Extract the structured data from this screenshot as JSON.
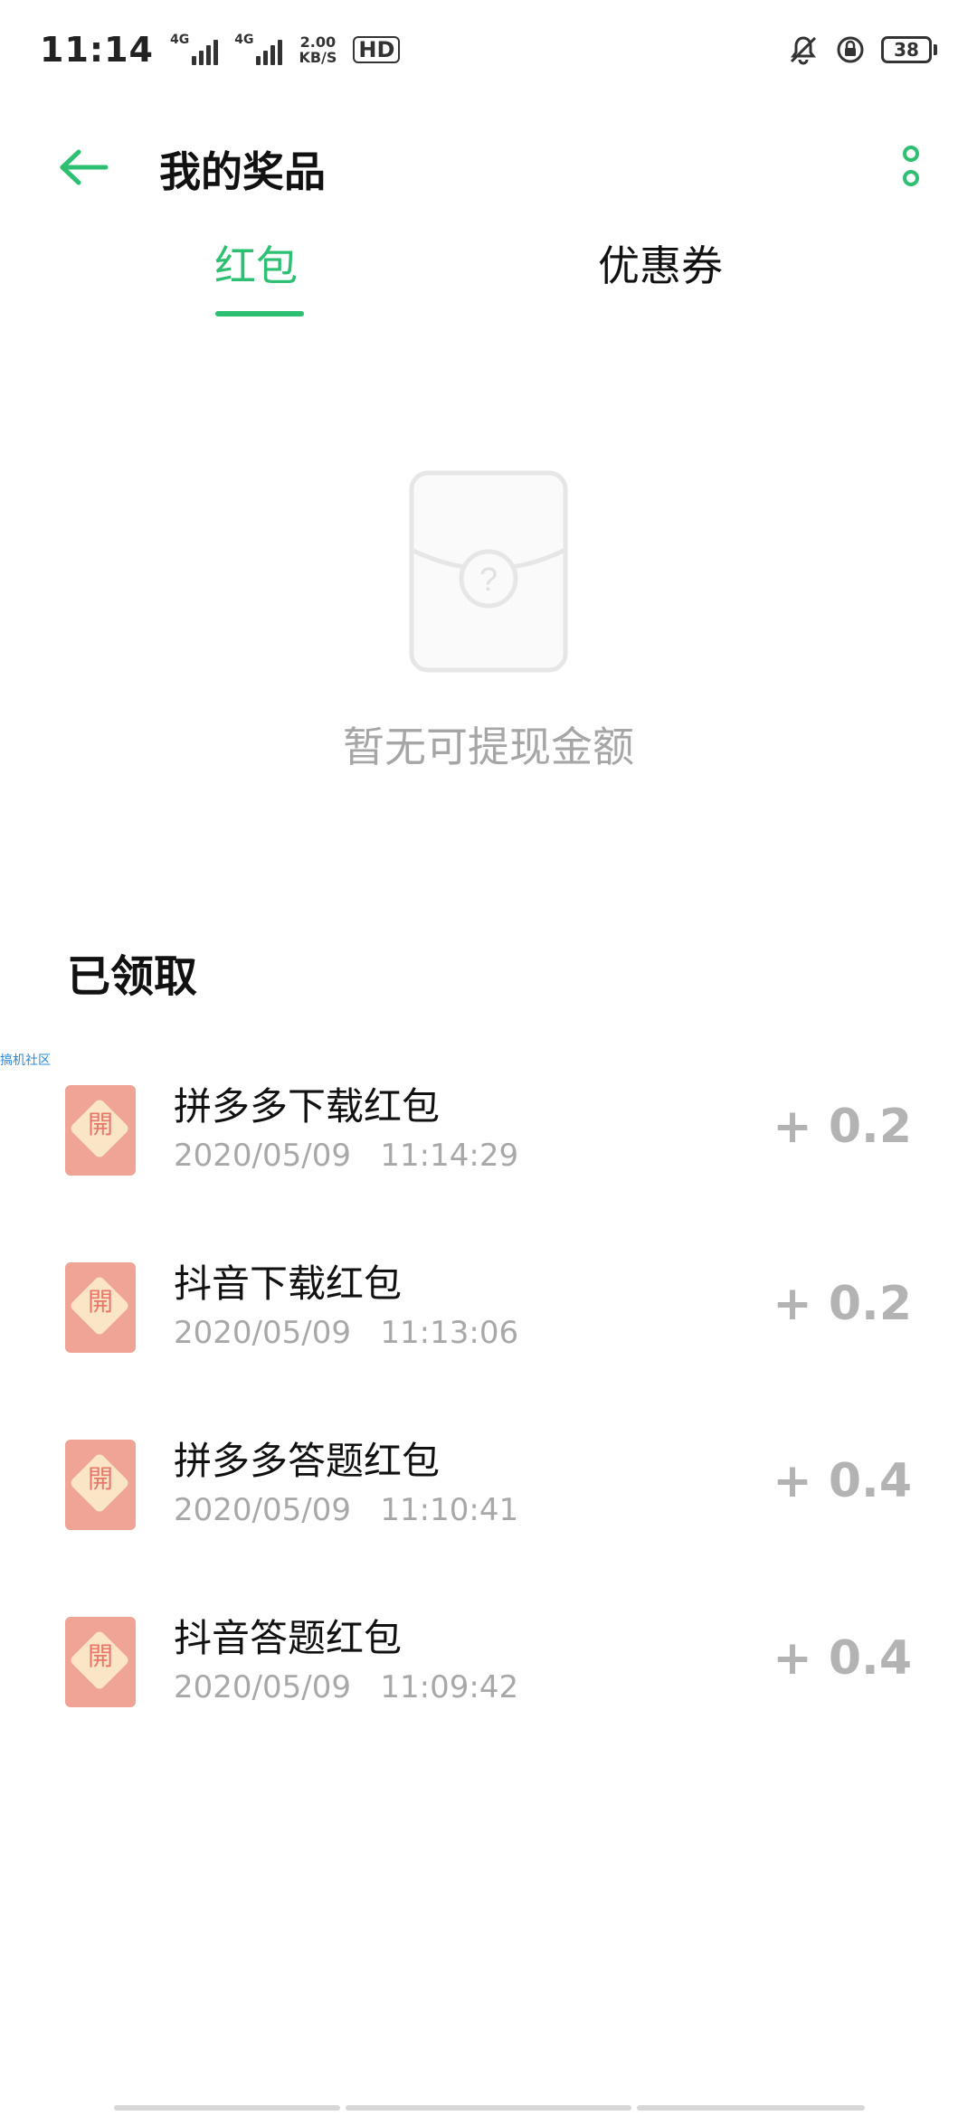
{
  "status_bar": {
    "time": "11:14",
    "net_speed": "2.00\nKB/S",
    "hd": "HD",
    "battery": "38",
    "signal_label_1": "4G",
    "signal_label_2": "4G"
  },
  "header": {
    "title": "我的奖品"
  },
  "tabs": [
    {
      "label": "红包",
      "active": true
    },
    {
      "label": "优惠券",
      "active": false
    }
  ],
  "empty_state": {
    "text": "暂无可提现金额"
  },
  "section": {
    "title": "已领取"
  },
  "watermark": "搞机社区",
  "rewards": [
    {
      "icon_char": "開",
      "title": "拼多多下载红包",
      "time": "2020/05/09   11:14:29",
      "amount": "+ 0.2"
    },
    {
      "icon_char": "開",
      "title": "抖音下载红包",
      "time": "2020/05/09   11:13:06",
      "amount": "+ 0.2"
    },
    {
      "icon_char": "開",
      "title": "拼多多答题红包",
      "time": "2020/05/09   11:10:41",
      "amount": "+ 0.4"
    },
    {
      "icon_char": "開",
      "title": "抖音答题红包",
      "time": "2020/05/09   11:09:42",
      "amount": "+ 0.4"
    }
  ],
  "colors": {
    "accent": "#2dbf72",
    "muted_text": "#a8a8a8",
    "amount": "#b3b3b3",
    "red_packet": "#f0a496"
  }
}
